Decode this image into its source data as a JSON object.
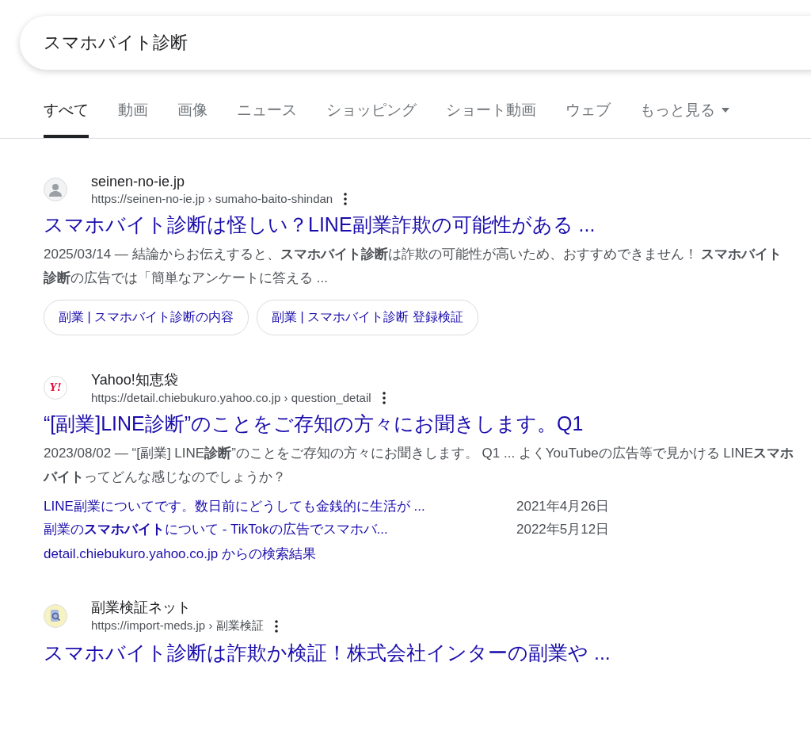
{
  "search": {
    "value": "スマホバイト診断"
  },
  "tabs": [
    {
      "label": "すべて",
      "selected": true
    },
    {
      "label": "動画",
      "selected": false
    },
    {
      "label": "画像",
      "selected": false
    },
    {
      "label": "ニュース",
      "selected": false
    },
    {
      "label": "ショッピング",
      "selected": false
    },
    {
      "label": "ショート動画",
      "selected": false
    },
    {
      "label": "ウェブ",
      "selected": false
    },
    {
      "label": "もっと見る",
      "selected": false,
      "dropdown": true
    }
  ],
  "results": [
    {
      "favicon": {
        "kind": "avatar"
      },
      "site": "seinen-no-ie.jp",
      "url": "https://seinen-no-ie.jp › sumaho-baito-shindan",
      "title": "スマホバイト診断は怪しい？LINE副業詐欺の可能性がある ...",
      "snippet": "2025/03/14 — 結論からお伝えすると、**スマホバイト診断**は詐欺の可能性が高いため、おすすめできません！ **スマホバイト診断**の広告では「簡単なアンケートに答える ...",
      "chips": [
        "副業 | スマホバイト診断の内容",
        "副業 | スマホバイト診断 登録検証"
      ]
    },
    {
      "favicon": {
        "kind": "text",
        "text": "Y!"
      },
      "site": "Yahoo!知恵袋",
      "url": "https://detail.chiebukuro.yahoo.co.jp › question_detail",
      "title": "“[副業]LINE診断”のことをご存知の方々にお聞きします。Q1",
      "snippet": "2023/08/02 — “[副業] LINE**診断**”のことをご存知の方々にお聞きします。 Q1 ... よくYouTubeの広告等で見かける LINE**スマホバイト**ってどんな感じなのでしょうか？",
      "subresults": [
        {
          "title": "LINE副業についてです。数日前にどうしても金銭的に生活が ...",
          "date": "2021年4月26日"
        },
        {
          "title": "副業の**スマホバイト**について - TikTokの広告でスマホバ...",
          "date": "2022年5月12日"
        }
      ],
      "more_link": "detail.chiebukuro.yahoo.co.jp からの検索結果"
    },
    {
      "favicon": {
        "kind": "magnifier"
      },
      "site": "副業検証ネット",
      "url": "https://import-meds.jp › 副業検証",
      "title": "スマホバイト診断は詐欺か検証！株式会社インターの副業や ..."
    }
  ]
}
